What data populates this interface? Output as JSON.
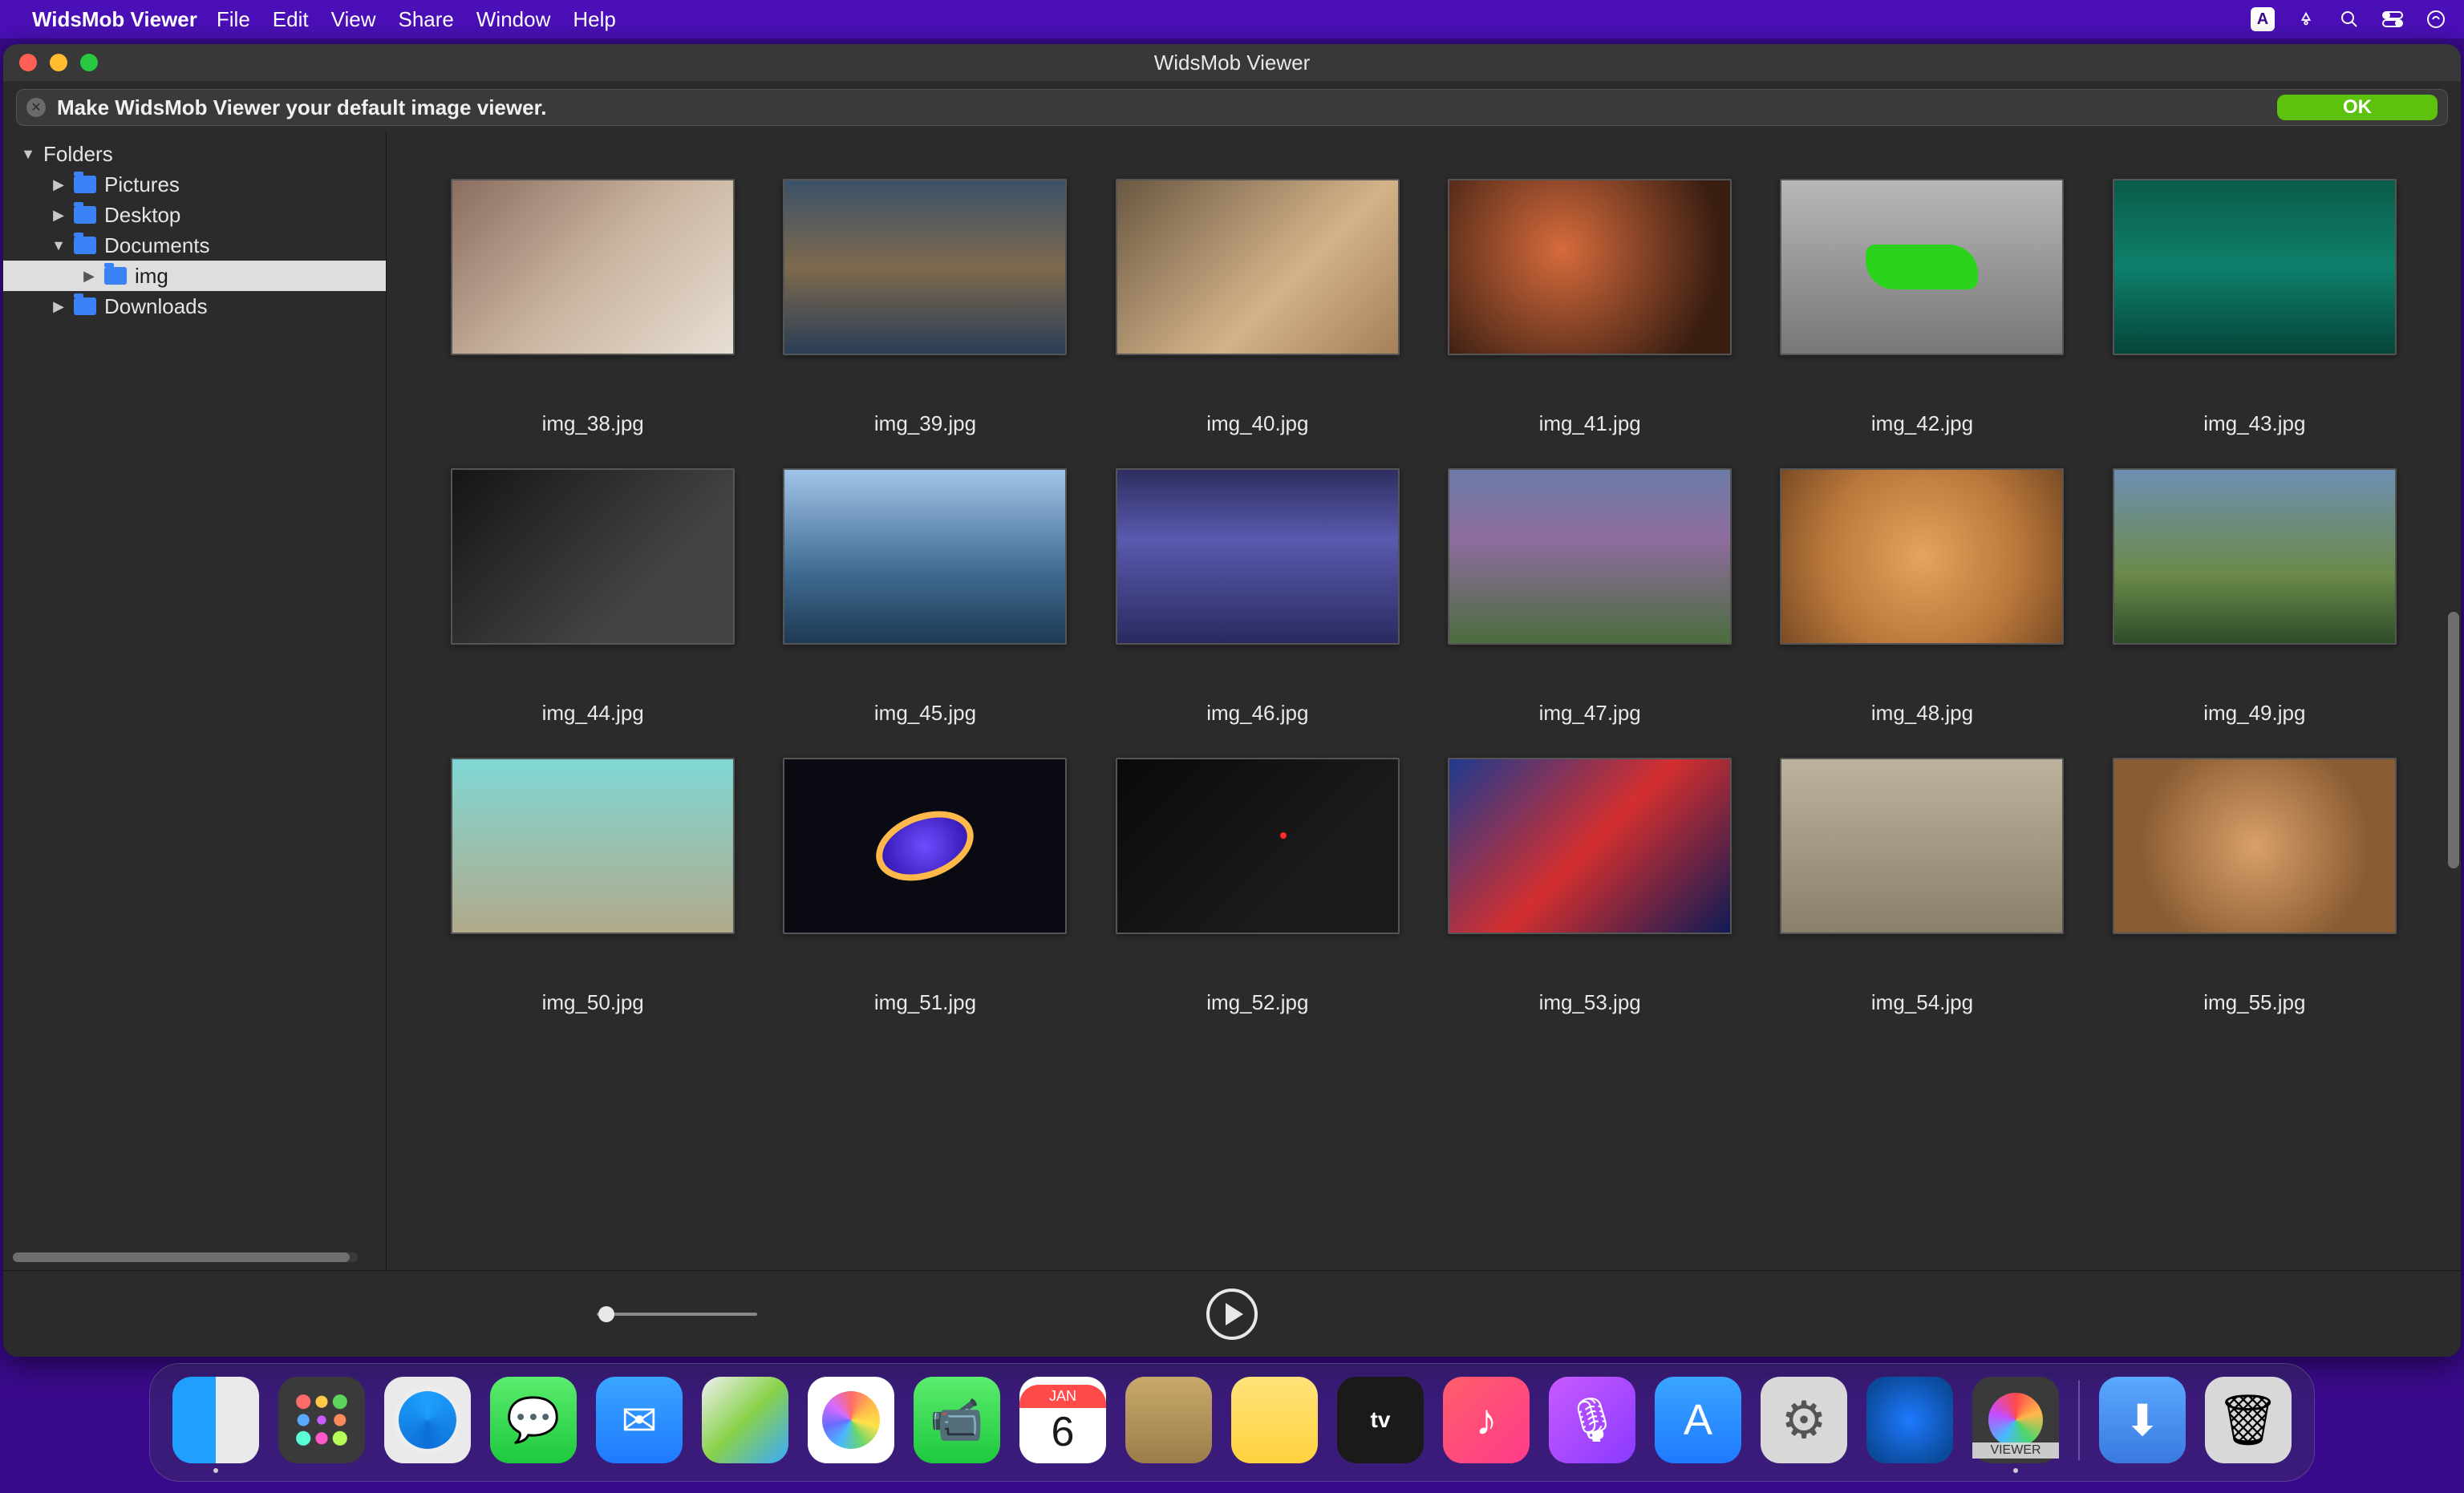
{
  "menubar": {
    "app_name": "WidsMob Viewer",
    "items": [
      "File",
      "Edit",
      "View",
      "Share",
      "Window",
      "Help"
    ],
    "input_method": "A"
  },
  "window": {
    "title": "WidsMob Viewer"
  },
  "banner": {
    "message": "Make WidsMob Viewer your default image viewer.",
    "ok_label": "OK"
  },
  "sidebar": {
    "root_label": "Folders",
    "items": [
      {
        "label": "Pictures",
        "depth": 1,
        "expanded": false
      },
      {
        "label": "Desktop",
        "depth": 1,
        "expanded": false
      },
      {
        "label": "Documents",
        "depth": 1,
        "expanded": true
      },
      {
        "label": "img",
        "depth": 2,
        "expanded": false,
        "selected": true
      },
      {
        "label": "Downloads",
        "depth": 1,
        "expanded": false
      }
    ]
  },
  "grid": {
    "thumbnails": [
      {
        "filename": "img_38.jpg"
      },
      {
        "filename": "img_39.jpg"
      },
      {
        "filename": "img_40.jpg"
      },
      {
        "filename": "img_41.jpg"
      },
      {
        "filename": "img_42.jpg"
      },
      {
        "filename": "img_43.jpg"
      },
      {
        "filename": "img_44.jpg"
      },
      {
        "filename": "img_45.jpg"
      },
      {
        "filename": "img_46.jpg"
      },
      {
        "filename": "img_47.jpg"
      },
      {
        "filename": "img_48.jpg"
      },
      {
        "filename": "img_49.jpg"
      },
      {
        "filename": "img_50.jpg"
      },
      {
        "filename": "img_51.jpg"
      },
      {
        "filename": "img_52.jpg"
      },
      {
        "filename": "img_53.jpg"
      },
      {
        "filename": "img_54.jpg"
      },
      {
        "filename": "img_55.jpg"
      }
    ]
  },
  "dock": {
    "calendar": {
      "month": "JAN",
      "day": "6"
    },
    "tv_label": "tv",
    "viewer_label": "VIEWER"
  }
}
